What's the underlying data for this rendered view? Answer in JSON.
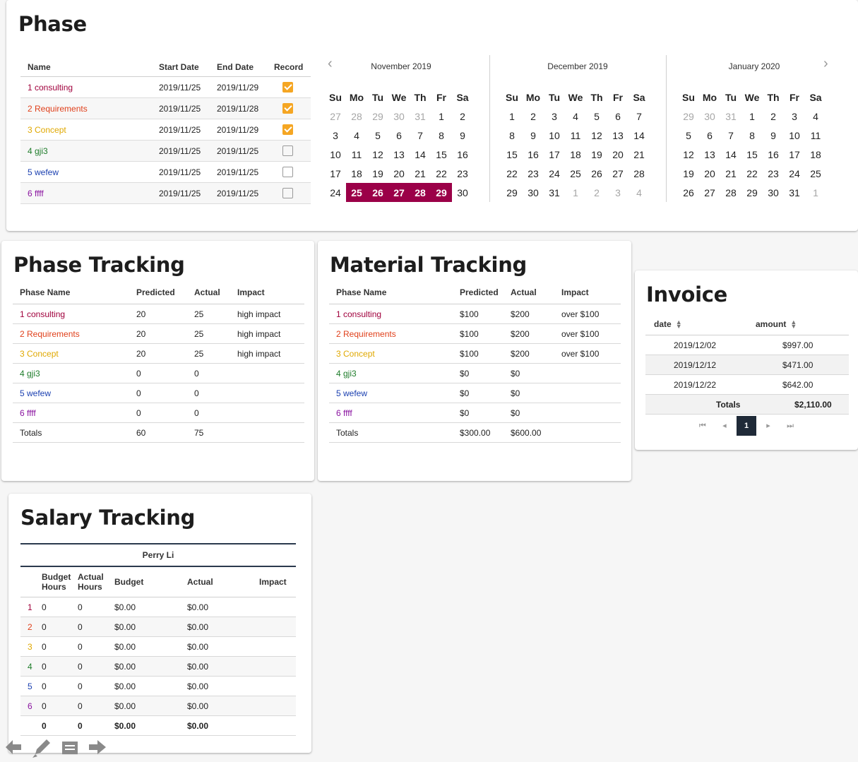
{
  "phase": {
    "title": "Phase",
    "headers": {
      "name": "Name",
      "start": "Start Date",
      "end": "End Date",
      "record": "Record"
    },
    "rows": [
      {
        "name": "1 consulting",
        "start": "2019/11/25",
        "end": "2019/11/29",
        "record": true
      },
      {
        "name": "2 Requirements",
        "start": "2019/11/25",
        "end": "2019/11/28",
        "record": true
      },
      {
        "name": "3 Concept",
        "start": "2019/11/25",
        "end": "2019/11/29",
        "record": true
      },
      {
        "name": "4 gji3",
        "start": "2019/11/25",
        "end": "2019/11/25",
        "record": false
      },
      {
        "name": "5 wefew",
        "start": "2019/11/25",
        "end": "2019/11/25",
        "record": false
      },
      {
        "name": "6 ffff",
        "start": "2019/11/25",
        "end": "2019/11/25",
        "record": false
      }
    ],
    "calendar": {
      "weekdays": [
        "Su",
        "Mo",
        "Tu",
        "We",
        "Th",
        "Fr",
        "Sa"
      ],
      "months": [
        {
          "title": "November 2019",
          "weeks": [
            [
              "27",
              "28",
              "29",
              "30",
              "31",
              "1",
              "2"
            ],
            [
              "3",
              "4",
              "5",
              "6",
              "7",
              "8",
              "9"
            ],
            [
              "10",
              "11",
              "12",
              "13",
              "14",
              "15",
              "16"
            ],
            [
              "17",
              "18",
              "19",
              "20",
              "21",
              "22",
              "23"
            ],
            [
              "24",
              "25",
              "26",
              "27",
              "28",
              "29",
              "30"
            ]
          ],
          "outside": [
            [
              0,
              0
            ],
            [
              0,
              1
            ],
            [
              0,
              2
            ],
            [
              0,
              3
            ],
            [
              0,
              4
            ]
          ],
          "selected": [
            [
              4,
              1
            ],
            [
              4,
              2
            ],
            [
              4,
              3
            ],
            [
              4,
              4
            ],
            [
              4,
              5
            ]
          ]
        },
        {
          "title": "December 2019",
          "weeks": [
            [
              "1",
              "2",
              "3",
              "4",
              "5",
              "6",
              "7"
            ],
            [
              "8",
              "9",
              "10",
              "11",
              "12",
              "13",
              "14"
            ],
            [
              "15",
              "16",
              "17",
              "18",
              "19",
              "20",
              "21"
            ],
            [
              "22",
              "23",
              "24",
              "25",
              "26",
              "27",
              "28"
            ],
            [
              "29",
              "30",
              "31",
              "1",
              "2",
              "3",
              "4"
            ]
          ],
          "outside": [
            [
              4,
              3
            ],
            [
              4,
              4
            ],
            [
              4,
              5
            ],
            [
              4,
              6
            ]
          ],
          "selected": []
        },
        {
          "title": "January 2020",
          "weeks": [
            [
              "29",
              "30",
              "31",
              "1",
              "2",
              "3",
              "4"
            ],
            [
              "5",
              "6",
              "7",
              "8",
              "9",
              "10",
              "11"
            ],
            [
              "12",
              "13",
              "14",
              "15",
              "16",
              "17",
              "18"
            ],
            [
              "19",
              "20",
              "21",
              "22",
              "23",
              "24",
              "25"
            ],
            [
              "26",
              "27",
              "28",
              "29",
              "30",
              "31",
              "1"
            ]
          ],
          "outside": [
            [
              0,
              0
            ],
            [
              0,
              1
            ],
            [
              0,
              2
            ],
            [
              4,
              6
            ]
          ],
          "selected": []
        }
      ]
    }
  },
  "phase_tracking": {
    "title": "Phase Tracking",
    "headers": {
      "name": "Phase Name",
      "predicted": "Predicted",
      "actual": "Actual",
      "impact": "Impact"
    },
    "rows": [
      {
        "name": "1 consulting",
        "predicted": "20",
        "actual": "25",
        "impact": "high impact"
      },
      {
        "name": "2 Requirements",
        "predicted": "20",
        "actual": "25",
        "impact": "high impact"
      },
      {
        "name": "3 Concept",
        "predicted": "20",
        "actual": "25",
        "impact": "high impact"
      },
      {
        "name": "4 gji3",
        "predicted": "0",
        "actual": "0",
        "impact": ""
      },
      {
        "name": "5 wefew",
        "predicted": "0",
        "actual": "0",
        "impact": ""
      },
      {
        "name": "6 ffff",
        "predicted": "0",
        "actual": "0",
        "impact": ""
      }
    ],
    "totals": {
      "label": "Totals",
      "predicted": "60",
      "actual": "75"
    }
  },
  "material_tracking": {
    "title": "Material Tracking",
    "headers": {
      "name": "Phase Name",
      "predicted": "Predicted",
      "actual": "Actual",
      "impact": "Impact"
    },
    "rows": [
      {
        "name": "1 consulting",
        "predicted": "$100",
        "actual": "$200",
        "impact": "over $100"
      },
      {
        "name": "2 Requirements",
        "predicted": "$100",
        "actual": "$200",
        "impact": "over $100"
      },
      {
        "name": "3 Concept",
        "predicted": "$100",
        "actual": "$200",
        "impact": "over $100"
      },
      {
        "name": "4 gji3",
        "predicted": "$0",
        "actual": "$0",
        "impact": ""
      },
      {
        "name": "5 wefew",
        "predicted": "$0",
        "actual": "$0",
        "impact": ""
      },
      {
        "name": "6 ffff",
        "predicted": "$0",
        "actual": "$0",
        "impact": ""
      }
    ],
    "totals": {
      "label": "Totals",
      "predicted": "$300.00",
      "actual": "$600.00"
    }
  },
  "invoice": {
    "title": "Invoice",
    "headers": {
      "date": "date",
      "amount": "amount"
    },
    "rows": [
      {
        "date": "2019/12/02",
        "amount": "$997.00"
      },
      {
        "date": "2019/12/12",
        "amount": "$471.00"
      },
      {
        "date": "2019/12/22",
        "amount": "$642.00"
      }
    ],
    "totals": {
      "label": "Totals",
      "amount": "$2,110.00"
    },
    "pager": {
      "current": "1"
    }
  },
  "salary_tracking": {
    "title": "Salary Tracking",
    "person": "Perry Li",
    "headers": {
      "budget_hours": "Budget Hours",
      "actual_hours": "Actual Hours",
      "budget": "Budget",
      "actual": "Actual",
      "impact": "Impact"
    },
    "rows": [
      {
        "phase": "1",
        "budget_hours": "0",
        "actual_hours": "0",
        "budget": "$0.00",
        "actual": "$0.00",
        "impact": ""
      },
      {
        "phase": "2",
        "budget_hours": "0",
        "actual_hours": "0",
        "budget": "$0.00",
        "actual": "$0.00",
        "impact": ""
      },
      {
        "phase": "3",
        "budget_hours": "0",
        "actual_hours": "0",
        "budget": "$0.00",
        "actual": "$0.00",
        "impact": ""
      },
      {
        "phase": "4",
        "budget_hours": "0",
        "actual_hours": "0",
        "budget": "$0.00",
        "actual": "$0.00",
        "impact": ""
      },
      {
        "phase": "5",
        "budget_hours": "0",
        "actual_hours": "0",
        "budget": "$0.00",
        "actual": "$0.00",
        "impact": ""
      },
      {
        "phase": "6",
        "budget_hours": "0",
        "actual_hours": "0",
        "budget": "$0.00",
        "actual": "$0.00",
        "impact": ""
      }
    ],
    "totals": {
      "budget_hours": "0",
      "actual_hours": "0",
      "budget": "$0.00",
      "actual": "$0.00"
    }
  },
  "phase_colors": [
    "#a0003c",
    "#e0401b",
    "#e0a800",
    "#1e7c2a",
    "#1a3fb0",
    "#8a14a0"
  ],
  "accent_colors": {
    "calendar_selected": "#9b0048",
    "checkbox": "#f5a623",
    "pager_active": "#1f2a38"
  },
  "toolbar": {
    "icons": [
      "arrow-left-icon",
      "pencil-icon",
      "notes-icon",
      "arrow-right-icon"
    ]
  }
}
